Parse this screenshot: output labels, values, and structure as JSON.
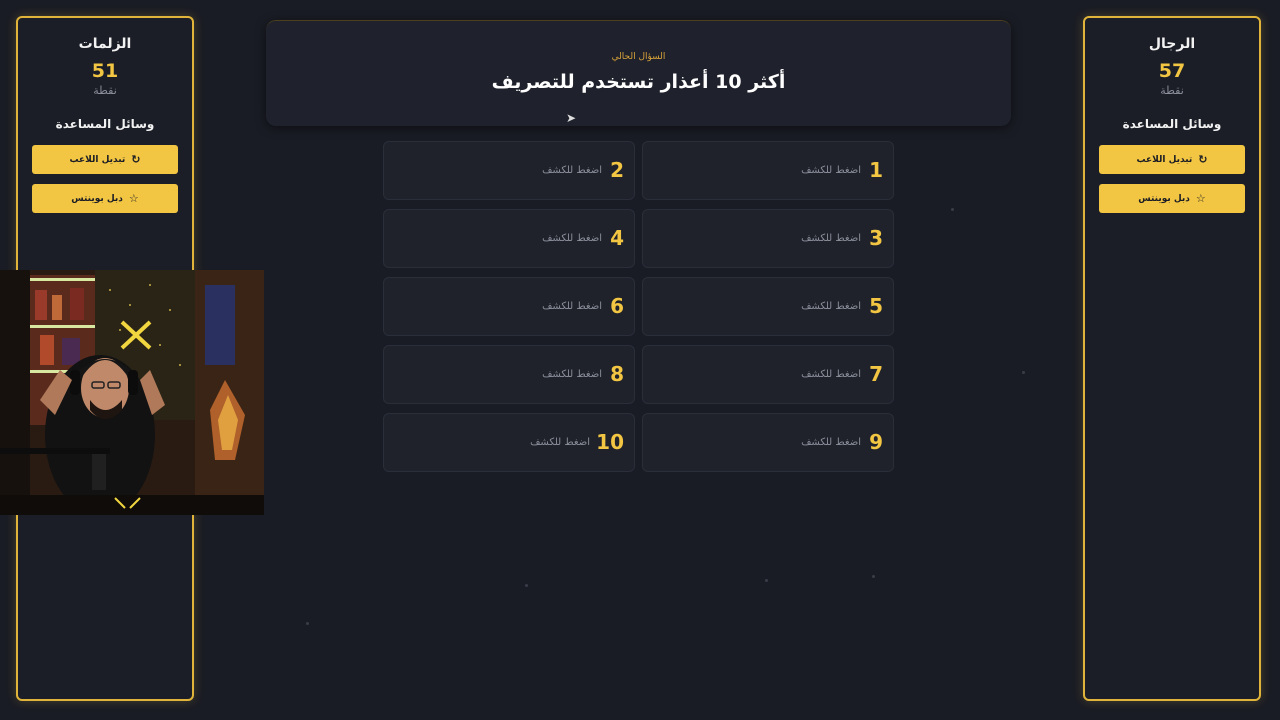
{
  "left_team": {
    "name": "الزلمات",
    "score": "51",
    "points_label": "نقطة",
    "aids_title": "وسائل المساعدة",
    "aids": [
      {
        "label": "تبديل اللاعب",
        "icon": "refresh-icon"
      },
      {
        "label": "دبل بوينتس",
        "icon": "star-icon"
      }
    ]
  },
  "right_team": {
    "name": "الرجال",
    "score": "57",
    "points_label": "نقطة",
    "aids_title": "وسائل المساعدة",
    "aids": [
      {
        "label": "تبديل اللاعب",
        "icon": "refresh-icon"
      },
      {
        "label": "دبل بوينتس",
        "icon": "star-icon"
      }
    ]
  },
  "question": {
    "label": "السؤال الحالي",
    "text": "أكثر 10 أعذار تستخدم للتصريف"
  },
  "answers": [
    {
      "number": "1",
      "hint": "اضغط للكشف"
    },
    {
      "number": "2",
      "hint": "اضغط للكشف"
    },
    {
      "number": "3",
      "hint": "اضغط للكشف"
    },
    {
      "number": "4",
      "hint": "اضغط للكشف"
    },
    {
      "number": "5",
      "hint": "اضغط للكشف"
    },
    {
      "number": "6",
      "hint": "اضغط للكشف"
    },
    {
      "number": "7",
      "hint": "اضغط للكشف"
    },
    {
      "number": "8",
      "hint": "اضغط للكشف"
    },
    {
      "number": "9",
      "hint": "اضغط للكشف"
    },
    {
      "number": "10",
      "hint": "اضغط للكشف"
    }
  ],
  "colors": {
    "accent": "#f2c542",
    "background": "#1a1c25",
    "panel_border": "#e0b43a"
  }
}
